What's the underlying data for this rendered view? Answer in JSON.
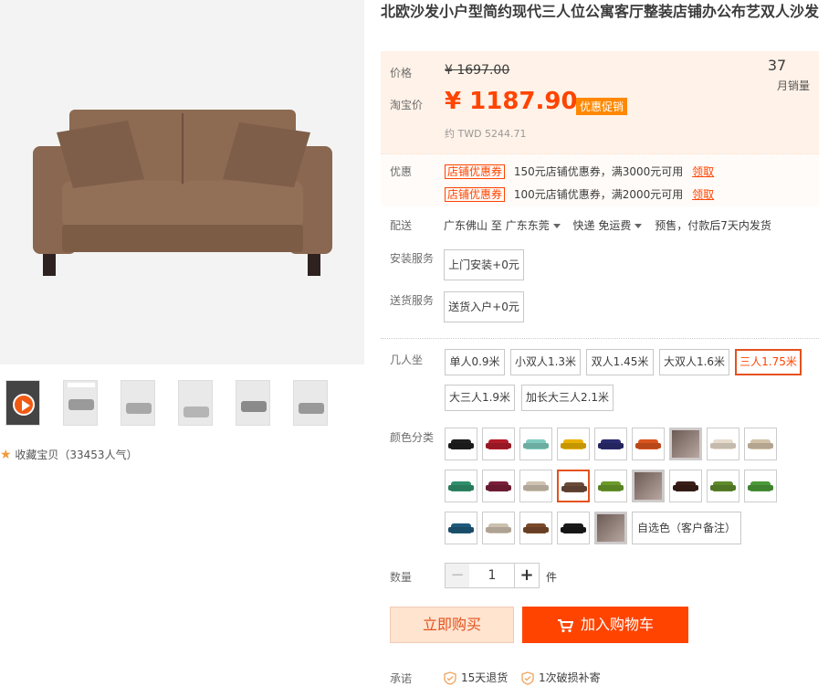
{
  "product": {
    "title": "北欧沙发小户型简约现代三人位公寓客厅整装店铺办公布艺双人沙发"
  },
  "gallery": {
    "favorite": "收藏宝贝（33453人气）"
  },
  "price": {
    "label": "价格",
    "original": "¥ 1697.00",
    "promo_label": "淘宝价",
    "current": "¥ 1187.90",
    "promo_tag": "优惠促销",
    "twd": "约 TWD 5244.71",
    "sales_count": "37",
    "sales_label": "月销量"
  },
  "coupons": {
    "label": "优惠",
    "items": [
      {
        "badge": "店铺优惠券",
        "text": "150元店铺优惠券，满3000元可用",
        "link": "领取"
      },
      {
        "badge": "店铺优惠券",
        "text": "100元店铺优惠券，满2000元可用",
        "link": "领取"
      }
    ]
  },
  "delivery": {
    "label": "配送",
    "from": "广东佛山",
    "to_word": "至",
    "to": "广东东莞",
    "shipping": "快递 免运费",
    "note": "预售，付款后7天内发货"
  },
  "install": {
    "label": "安装服务",
    "option": "上门安装+0元"
  },
  "ship_service": {
    "label": "送货服务",
    "option": "送货入户+0元"
  },
  "seats": {
    "label": "几人坐",
    "options": [
      "单人0.9米",
      "小双人1.3米",
      "双人1.45米",
      "大双人1.6米",
      "三人1.75米",
      "大三人1.9米",
      "加长大三人2.1米"
    ],
    "selected": "三人1.75米"
  },
  "colors": {
    "label": "颜色分类",
    "swatches": [
      "#1e1e1e",
      "#b01c2a",
      "#7fcbbf",
      "#e8b000",
      "#2a2a6e",
      "#d9541e",
      "photo",
      "#e6dccd",
      "#d2c2a8",
      "#2f8f6a",
      "#7a1f3a",
      "#cfc3b2",
      "#6b4a3a",
      "#6a9a2a",
      "photo",
      "#3a1f18",
      "#5e8a2a",
      "#4a9a3a",
      "#1f5a7a",
      "#cbbfae",
      "#7a4a2a",
      "#1a1a1a",
      "photo"
    ],
    "selected_index": 12,
    "custom_option": "自选色（客户备注）"
  },
  "quantity": {
    "label": "数量",
    "value": "1",
    "minus": "−",
    "plus": "+",
    "unit": "件"
  },
  "actions": {
    "buy_now": "立即购买",
    "add_to_cart": "加入购物车"
  },
  "promise": {
    "label": "承诺",
    "items": [
      "15天退货",
      "1次破损补寄"
    ]
  },
  "accent_color": "#ff4400"
}
